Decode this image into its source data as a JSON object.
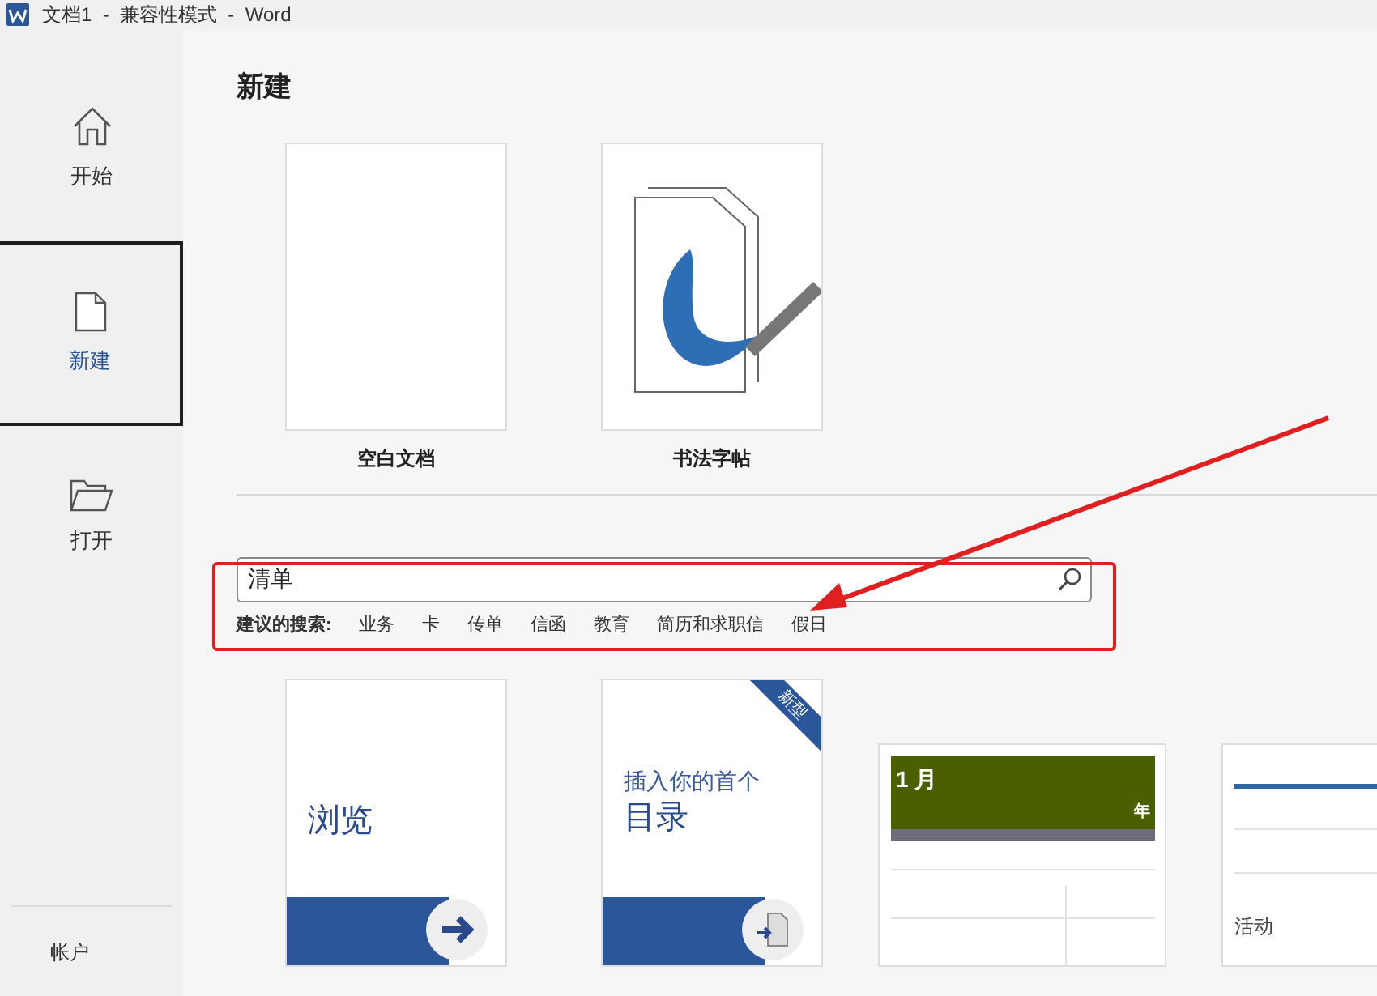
{
  "window": {
    "title": "文档1  -  兼容性模式  -  Word"
  },
  "sidebar": {
    "items": [
      {
        "label": "开始",
        "selected": false
      },
      {
        "label": "新建",
        "selected": true
      },
      {
        "label": "打开",
        "selected": false
      }
    ],
    "footer": "帐户"
  },
  "heading": "新建",
  "featured": [
    {
      "kind": "blank",
      "label": "空白文档"
    },
    {
      "kind": "calligraphy",
      "label": "书法字帖"
    }
  ],
  "search": {
    "value": "清单"
  },
  "suggestions": {
    "label": "建议的搜索:",
    "items": [
      "业务",
      "卡",
      "传单",
      "信函",
      "教育",
      "简历和求职信",
      "假日"
    ]
  },
  "templates": [
    {
      "kind": "browse",
      "title": "浏览"
    },
    {
      "kind": "toc",
      "subtitle": "插入你的首个",
      "title": "目录",
      "badge": "新型"
    },
    {
      "kind": "banner_calendar",
      "month": "1 月",
      "year": "年"
    },
    {
      "kind": "horizontal_calendar",
      "caption": "活动"
    }
  ]
}
